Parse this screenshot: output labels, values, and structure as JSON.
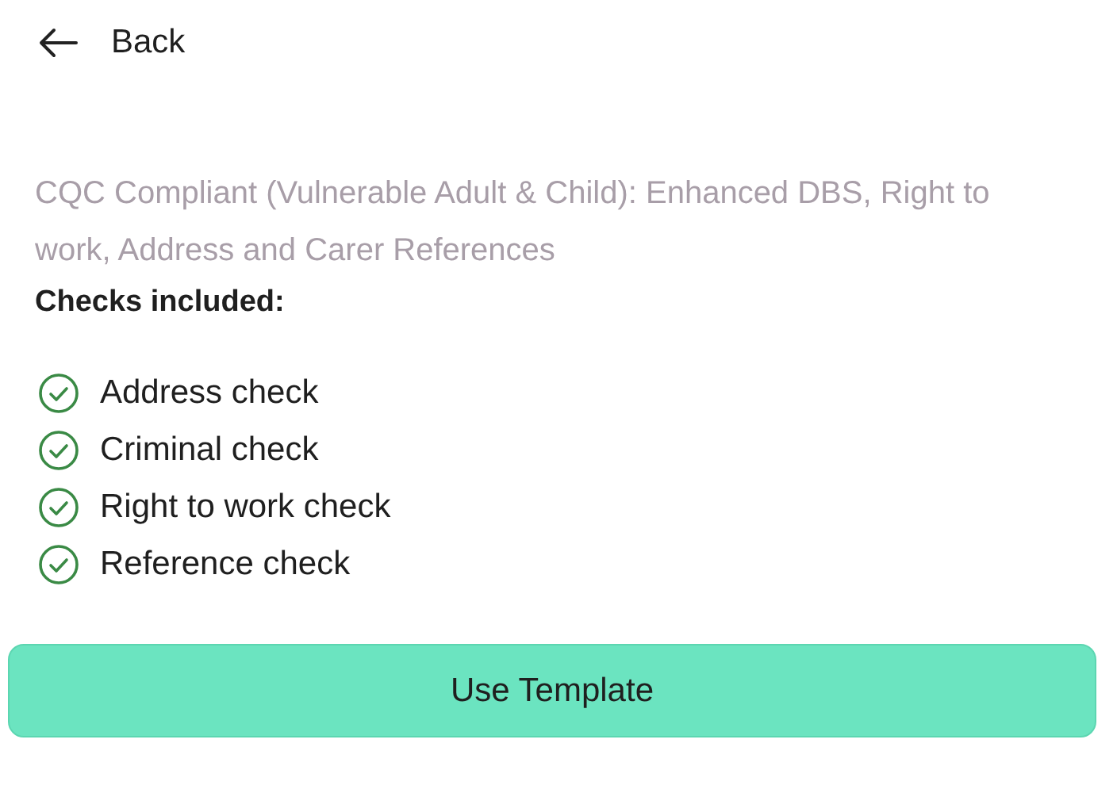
{
  "back": {
    "label": "Back"
  },
  "description": "CQC Compliant (Vulnerable Adult & Child): Enhanced DBS, Right to work, Address and Carer References",
  "checks_heading": "Checks included:",
  "checks": [
    {
      "label": "Address check"
    },
    {
      "label": "Criminal check"
    },
    {
      "label": "Right to work check"
    },
    {
      "label": "Reference check"
    }
  ],
  "button": {
    "label": "Use Template"
  }
}
